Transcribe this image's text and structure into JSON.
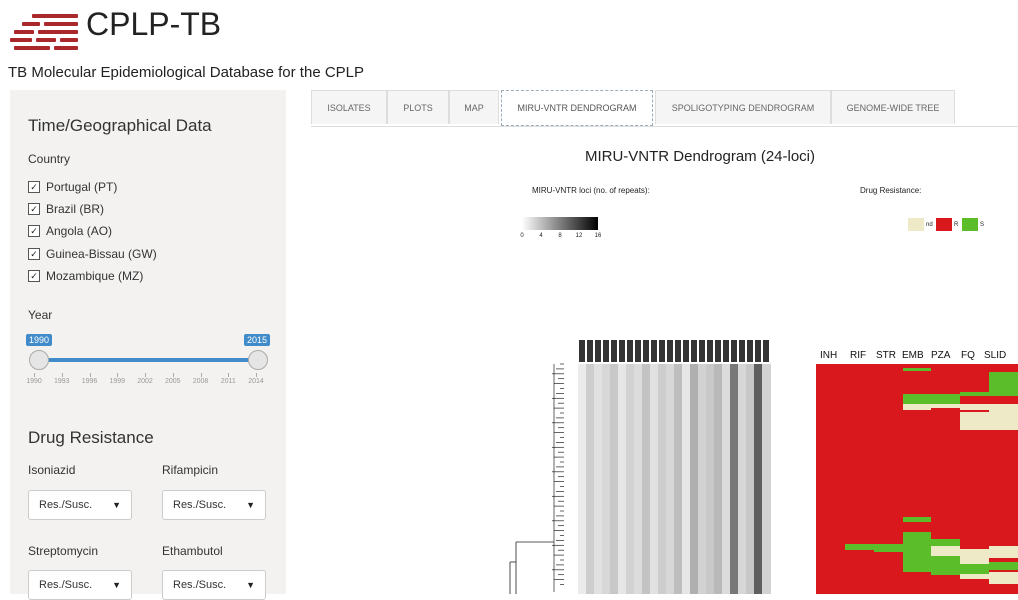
{
  "header": {
    "brand": "CPLP-TB",
    "subtitle": "TB Molecular Epidemiological Database for the CPLP",
    "logo_color": "#a8282c"
  },
  "sidebar": {
    "time_geo_title": "Time/Geographical Data",
    "country_label": "Country",
    "countries": [
      "Portugal (PT)",
      "Brazil (BR)",
      "Angola (AO)",
      "Guinea-Bissau (GW)",
      "Mozambique (MZ)"
    ],
    "year_label": "Year",
    "year_from": "1990",
    "year_to": "2015",
    "year_ticks": [
      "1990",
      "1993",
      "1996",
      "1999",
      "2002",
      "2005",
      "2008",
      "2011",
      "2014"
    ],
    "drug_title": "Drug Resistance",
    "drugs": [
      {
        "label": "Isoniazid",
        "value": "Res./Susc."
      },
      {
        "label": "Rifampicin",
        "value": "Res./Susc."
      },
      {
        "label": "Streptomycin",
        "value": "Res./Susc."
      },
      {
        "label": "Ethambutol",
        "value": "Res./Susc."
      }
    ]
  },
  "tabs": [
    "ISOLATES",
    "PLOTS",
    "MAP",
    "MIRU-VNTR DENDROGRAM",
    "SPOLIGOTYPING DENDROGRAM",
    "GENOME-WIDE TREE"
  ],
  "active_tab": "MIRU-VNTR DENDROGRAM",
  "dendrogram": {
    "title": "MIRU-VNTR Dendrogram (24-loci)",
    "loci_legend": "MIRU-VNTR loci (no. of repeats):",
    "scale_ticks": [
      "0",
      "4",
      "8",
      "12",
      "16"
    ],
    "drug_legend_title": "Drug Resistance:",
    "drug_legend": [
      {
        "label": "nd",
        "color": "#eeeac8"
      },
      {
        "label": "R",
        "color": "#d9181e"
      },
      {
        "label": "S",
        "color": "#5bbd2a"
      }
    ],
    "drug_columns": [
      "INH",
      "RIF",
      "STR",
      "EMB",
      "PZA",
      "FQ",
      "SLID"
    ]
  }
}
